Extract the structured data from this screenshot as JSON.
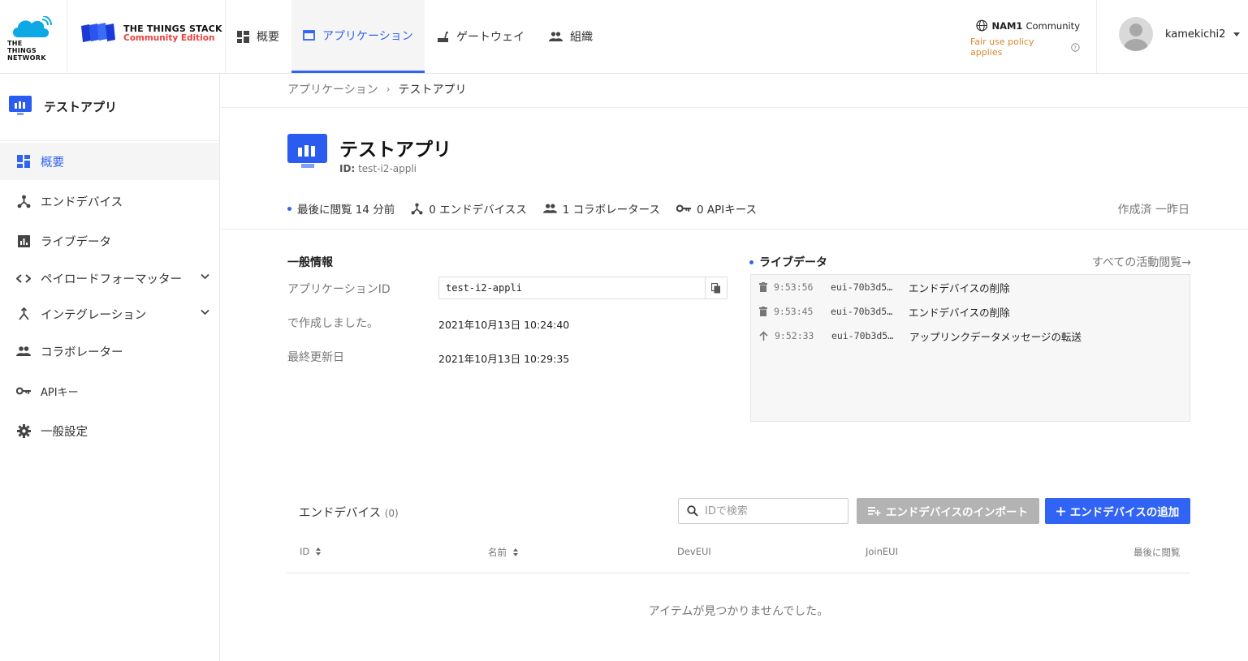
{
  "header": {
    "brand": {
      "ttn_line1": "THE THINGS",
      "ttn_line2": "NETWORK",
      "stack_title": "THE THINGS STACK",
      "stack_subtitle": "Community Edition"
    },
    "nav": [
      {
        "label": "概要",
        "icon": "dashboard-icon"
      },
      {
        "label": "アプリケーション",
        "icon": "application-icon",
        "active": true
      },
      {
        "label": "ゲートウェイ",
        "icon": "gateway-icon"
      },
      {
        "label": "組織",
        "icon": "organization-icon"
      }
    ],
    "cluster": {
      "name": "NAM1",
      "type": "Community",
      "fair_use": "Fair use policy applies"
    },
    "user": {
      "name": "kamekichi2"
    }
  },
  "sidebar": {
    "app_title": "テストアプリ",
    "items": [
      {
        "label": "概要",
        "icon": "dashboard-icon",
        "active": true
      },
      {
        "label": "エンドデバイス",
        "icon": "devices-icon"
      },
      {
        "label": "ライブデータ",
        "icon": "live-data-icon"
      },
      {
        "label": "ペイロードフォーマッター",
        "icon": "code-icon",
        "expandable": true
      },
      {
        "label": "インテグレーション",
        "icon": "integration-icon",
        "expandable": true
      },
      {
        "label": "コラボレーター",
        "icon": "collaborators-icon"
      },
      {
        "label": "APIキー",
        "icon": "key-icon"
      },
      {
        "label": "一般設定",
        "icon": "gear-icon"
      }
    ]
  },
  "breadcrumb": {
    "parent": "アプリケーション",
    "sep": "›",
    "current": "テストアプリ"
  },
  "app": {
    "title": "テストアプリ",
    "id_prefix": "ID:",
    "id": "test-i2-appli",
    "stats": {
      "last_seen": "最後に閲覧 14 分前",
      "devices": "0 エンドデバイスス",
      "collaborators": "1 コラボレータース",
      "api_keys": "0 APIキース"
    },
    "created": "作成済 一昨日"
  },
  "general": {
    "title": "一般情報",
    "app_id_label": "アプリケーションID",
    "app_id_value": "test-i2-appli",
    "created_label": "で作成しました。",
    "created_value": "2021年10月13日 10:24:40",
    "updated_label": "最終更新日",
    "updated_value": "2021年10月13日 10:29:35"
  },
  "live": {
    "title": "ライブデータ",
    "see_all": "すべての活動閲覧→",
    "events": [
      {
        "icon": "trash-icon",
        "time": "9:53:56",
        "device": "eui-70b3d5…",
        "message": "エンドデバイスの削除"
      },
      {
        "icon": "trash-icon",
        "time": "9:53:45",
        "device": "eui-70b3d5…",
        "message": "エンドデバイスの削除"
      },
      {
        "icon": "arrow-up-icon",
        "time": "9:52:33",
        "device": "eui-70b3d5…",
        "message": "アップリンクデータメッセージの転送"
      }
    ]
  },
  "devices": {
    "title": "エンドデバイス",
    "count": "(0)",
    "search_placeholder": "IDで検索",
    "import_label": "エンドデバイスのインポート",
    "add_label": "エンドデバイスの追加",
    "columns": [
      "ID",
      "名前",
      "DevEUI",
      "JoinEUI",
      "最後に閲覧"
    ],
    "empty": "アイテムが見つかりませんでした。"
  }
}
